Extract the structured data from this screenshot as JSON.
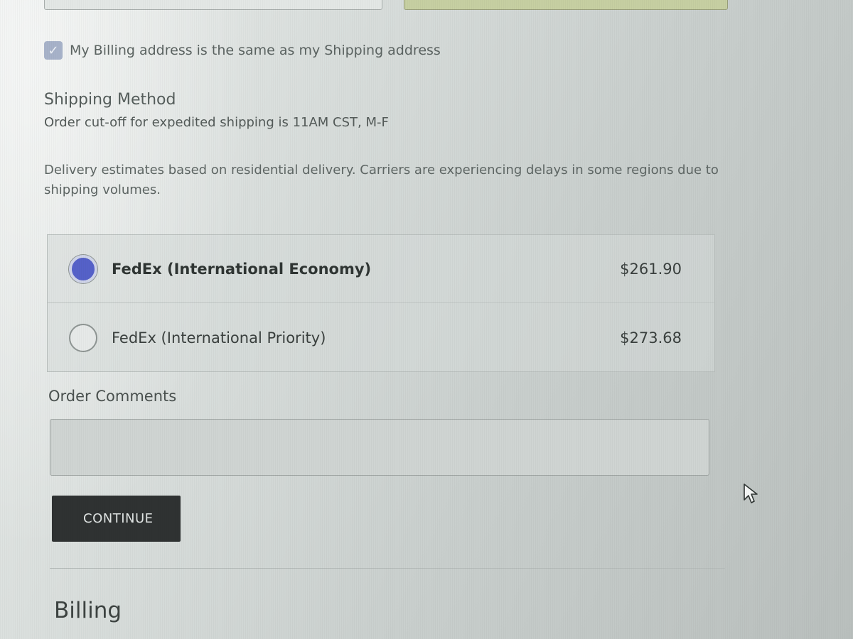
{
  "billing": {
    "same_as_shipping_label": "My Billing address is the same as my Shipping address",
    "same_as_shipping_checked": true,
    "section_title": "Billing"
  },
  "shipping_method": {
    "title": "Shipping Method",
    "cutoff_note": "Order cut-off for expedited shipping is 11AM CST, M-F",
    "delivery_note": "Delivery estimates based on residential delivery. Carriers are experiencing delays in some regions due to shipping volumes.",
    "options": [
      {
        "label": "FedEx (International Economy)",
        "price": "$261.90",
        "selected": true
      },
      {
        "label": "FedEx (International Priority)",
        "price": "$273.68",
        "selected": false
      }
    ]
  },
  "order_comments": {
    "label": "Order Comments",
    "value": ""
  },
  "actions": {
    "continue_label": "CONTINUE"
  },
  "icons": {
    "checkbox": "check-icon",
    "cursor": "mouse-pointer-icon"
  },
  "colors": {
    "radio_selected": "#5561c8",
    "checkbox_checked": "#a7b2c9",
    "continue_button": "#2f3232"
  }
}
